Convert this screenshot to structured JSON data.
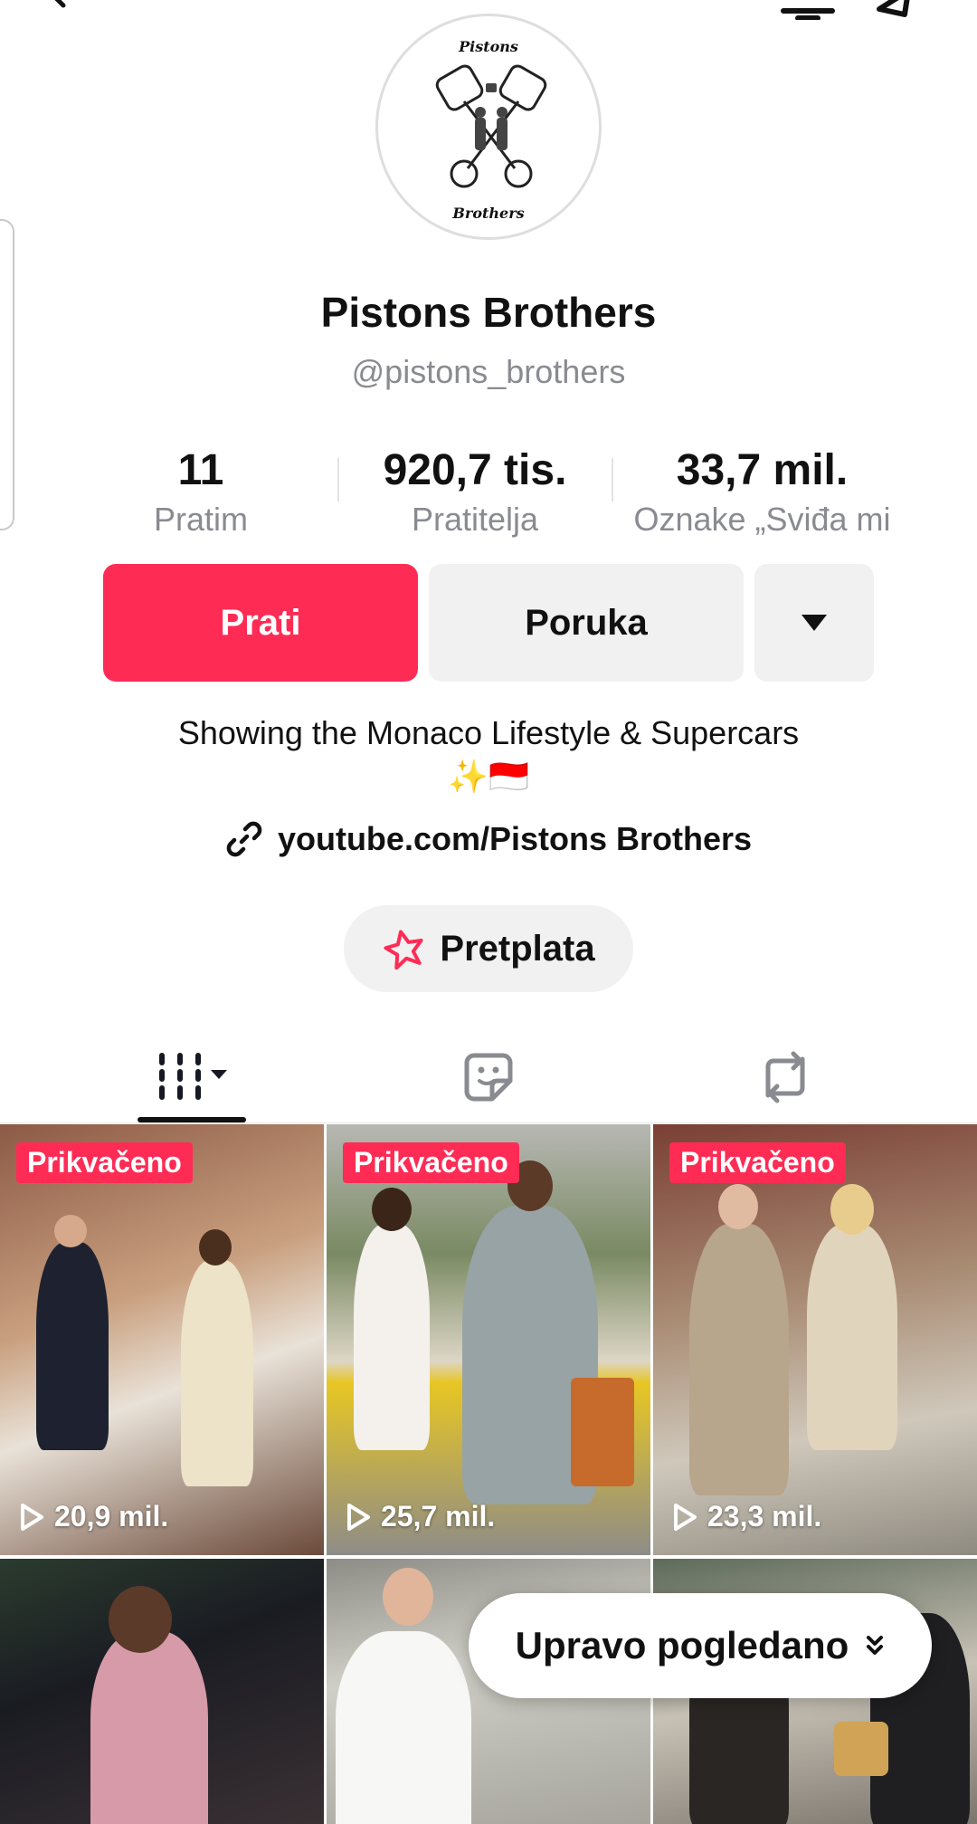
{
  "profile": {
    "display_name": "Pistons Brothers",
    "username": "@pistons_brothers",
    "logo_top_text": "Pistons",
    "logo_bottom_text": "Brothers"
  },
  "stats": [
    {
      "value": "11",
      "label": "Pratim"
    },
    {
      "value": "920,7 tis.",
      "label": "Pratitelja"
    },
    {
      "value": "33,7 mil.",
      "label": "Oznake „Sviđa mi"
    }
  ],
  "actions": {
    "follow_label": "Prati",
    "message_label": "Poruka"
  },
  "bio": {
    "text": "Showing the Monaco Lifestyle & Supercars",
    "emoji": "✨🇮🇩",
    "link": "youtube.com/Pistons Brothers"
  },
  "subscribe_label": "Pretplata",
  "tabs": [
    "videos-icon",
    "favorites-icon",
    "reposts-icon"
  ],
  "videos": [
    {
      "pinned_label": "Prikvačeno",
      "views": "20,9 mil."
    },
    {
      "pinned_label": "Prikvačeno",
      "views": "25,7 mil."
    },
    {
      "pinned_label": "Prikvačeno",
      "views": "23,3 mil."
    },
    {
      "pinned_label": "",
      "views": ""
    },
    {
      "pinned_label": "",
      "views": ""
    },
    {
      "pinned_label": "",
      "views": ""
    }
  ],
  "recently_watched_label": "Upravo pogledano",
  "colors": {
    "accent": "#fe2c55",
    "secondary_button": "#f1f1f2",
    "muted_text": "#8a8b91"
  }
}
